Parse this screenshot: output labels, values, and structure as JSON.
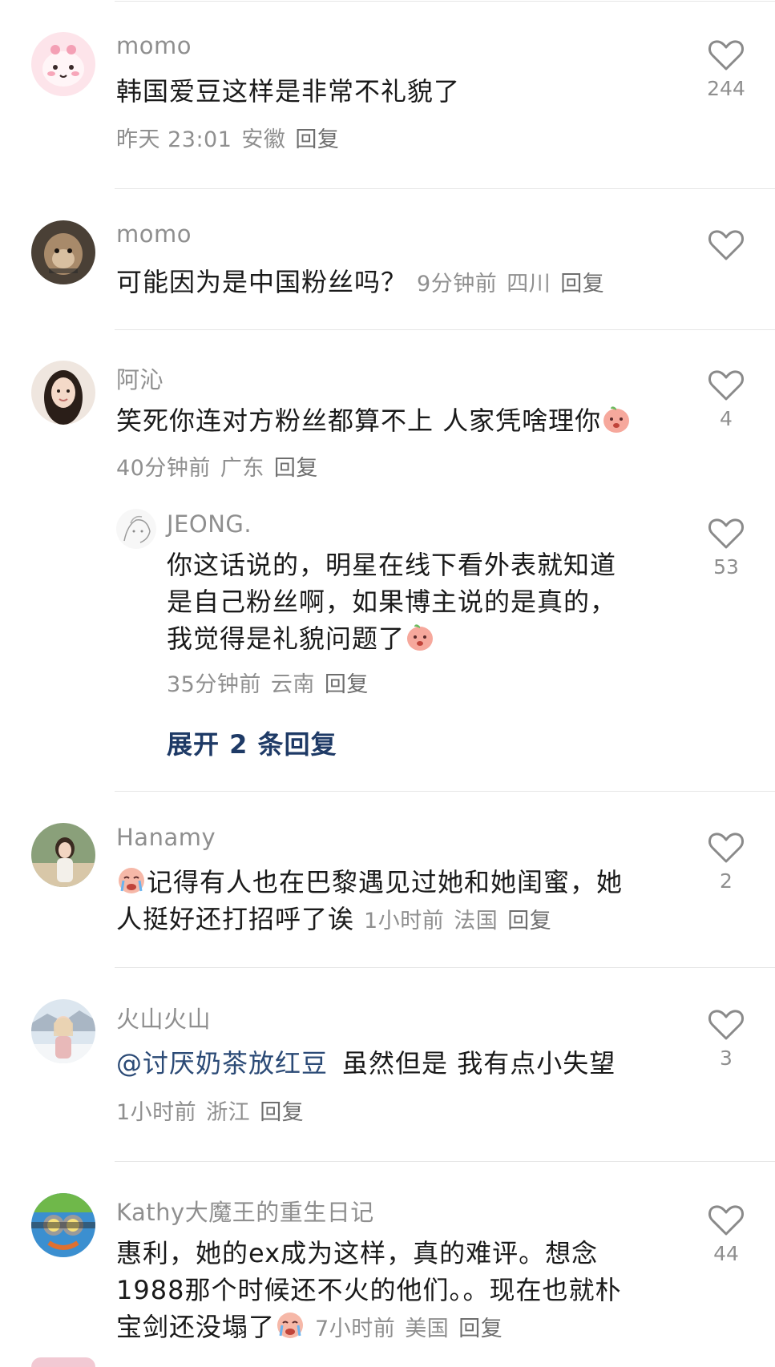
{
  "comments": [
    {
      "username": "momo",
      "text": "韩国爱豆这样是非常不礼貌了",
      "time": "昨天 23:01",
      "location": "安徽",
      "reply_label": "回复",
      "likes": "244",
      "avatar_icon": "pink-cartoon-avatar"
    },
    {
      "username": "momo",
      "text": "可能因为是中国粉丝吗？",
      "time": "9分钟前",
      "location": "四川",
      "reply_label": "回复",
      "likes": "",
      "avatar_icon": "monkey-photo-avatar"
    },
    {
      "username": "阿沁",
      "text": "笑死你连对方粉丝都算不上 人家凭啥理你",
      "time": "40分钟前",
      "location": "广东",
      "reply_label": "回复",
      "likes": "4",
      "avatar_icon": "woman-photo-avatar",
      "emoji_icon": "peach-face-emoji",
      "replies": [
        {
          "username": "JEONG.",
          "text_lines": [
            "你这话说的，明星在线下看外表就知道",
            "是自己粉丝啊，如果博主说的是真的，",
            "我觉得是礼貌问题了"
          ],
          "time": "35分钟前",
          "location": "云南",
          "reply_label": "回复",
          "likes": "53",
          "avatar_icon": "sketch-avatar",
          "emoji_icon": "peach-face-emoji"
        }
      ],
      "expand_label": "展开 2 条回复"
    },
    {
      "username": "Hanamy",
      "emoji_icon": "crying-face-emoji",
      "text_line1": "记得有人也在巴黎遇见过她和她闺蜜，她",
      "text_line2": "人挺好还打招呼了诶",
      "time": "1小时前",
      "location": "法国",
      "reply_label": "回复",
      "likes": "2",
      "avatar_icon": "girl-outdoor-photo-avatar"
    },
    {
      "username": "火山火山",
      "mention": "@讨厌奶茶放红豆",
      "text": "虽然但是 我有点小失望",
      "time": "1小时前",
      "location": "浙江",
      "reply_label": "回复",
      "likes": "3",
      "avatar_icon": "girl-snow-photo-avatar"
    },
    {
      "username": "Kathy大魔王的重生日记",
      "text_line1": "惠利，她的ex成为这样，真的难评。想念",
      "text_line2": "1988那个时候还不火的他们。。现在也就朴",
      "text_line3": "宝剑还没塌了",
      "time": "7小时前",
      "location": "美国",
      "reply_label": "回复",
      "likes": "44",
      "avatar_icon": "minion-avatar",
      "emoji_icon": "crying-face-emoji"
    }
  ],
  "icons": {
    "like": "heart-outline-icon"
  },
  "colors": {
    "link": "#2b4a76",
    "expand": "#1e3a66",
    "meta": "#8f8f8f"
  }
}
